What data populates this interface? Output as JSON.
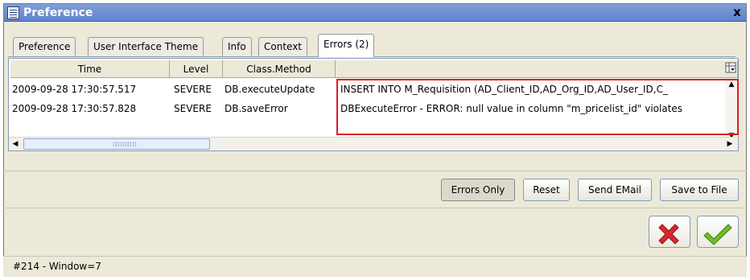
{
  "window": {
    "title": "Preference",
    "close_label": "x"
  },
  "tabs": [
    {
      "label": "Preference",
      "active": false
    },
    {
      "label": "User Interface Theme",
      "active": false
    },
    {
      "label": "Info",
      "active": false
    },
    {
      "label": "Context",
      "active": false
    },
    {
      "label": "Errors (2)",
      "active": true
    }
  ],
  "table": {
    "columns": [
      "Time",
      "Level",
      "Class.Method",
      ""
    ],
    "rows": [
      {
        "time": "2009-09-28 17:30:57.517",
        "level": "SEVERE",
        "method": "DB.executeUpdate",
        "message": "INSERT INTO M_Requisition (AD_Client_ID,AD_Org_ID,AD_User_ID,C_"
      },
      {
        "time": "2009-09-28 17:30:57.828",
        "level": "SEVERE",
        "method": "DB.saveError",
        "message": "DBExecuteError - ERROR: null value in column \"m_pricelist_id\" violates"
      }
    ]
  },
  "buttons": {
    "errors_only": "Errors Only",
    "reset": "Reset",
    "send_email": "Send EMail",
    "save_to_file": "Save to File"
  },
  "dialog_icons": {
    "cancel": "cancel-x-icon",
    "ok": "checkmark-icon"
  },
  "status": {
    "text": "#214 - Window=7"
  },
  "colors": {
    "title_bar": "#6b8fd5",
    "highlight": "#e01b24",
    "cancel_red": "#d9272e",
    "ok_green": "#6fbf2a"
  }
}
